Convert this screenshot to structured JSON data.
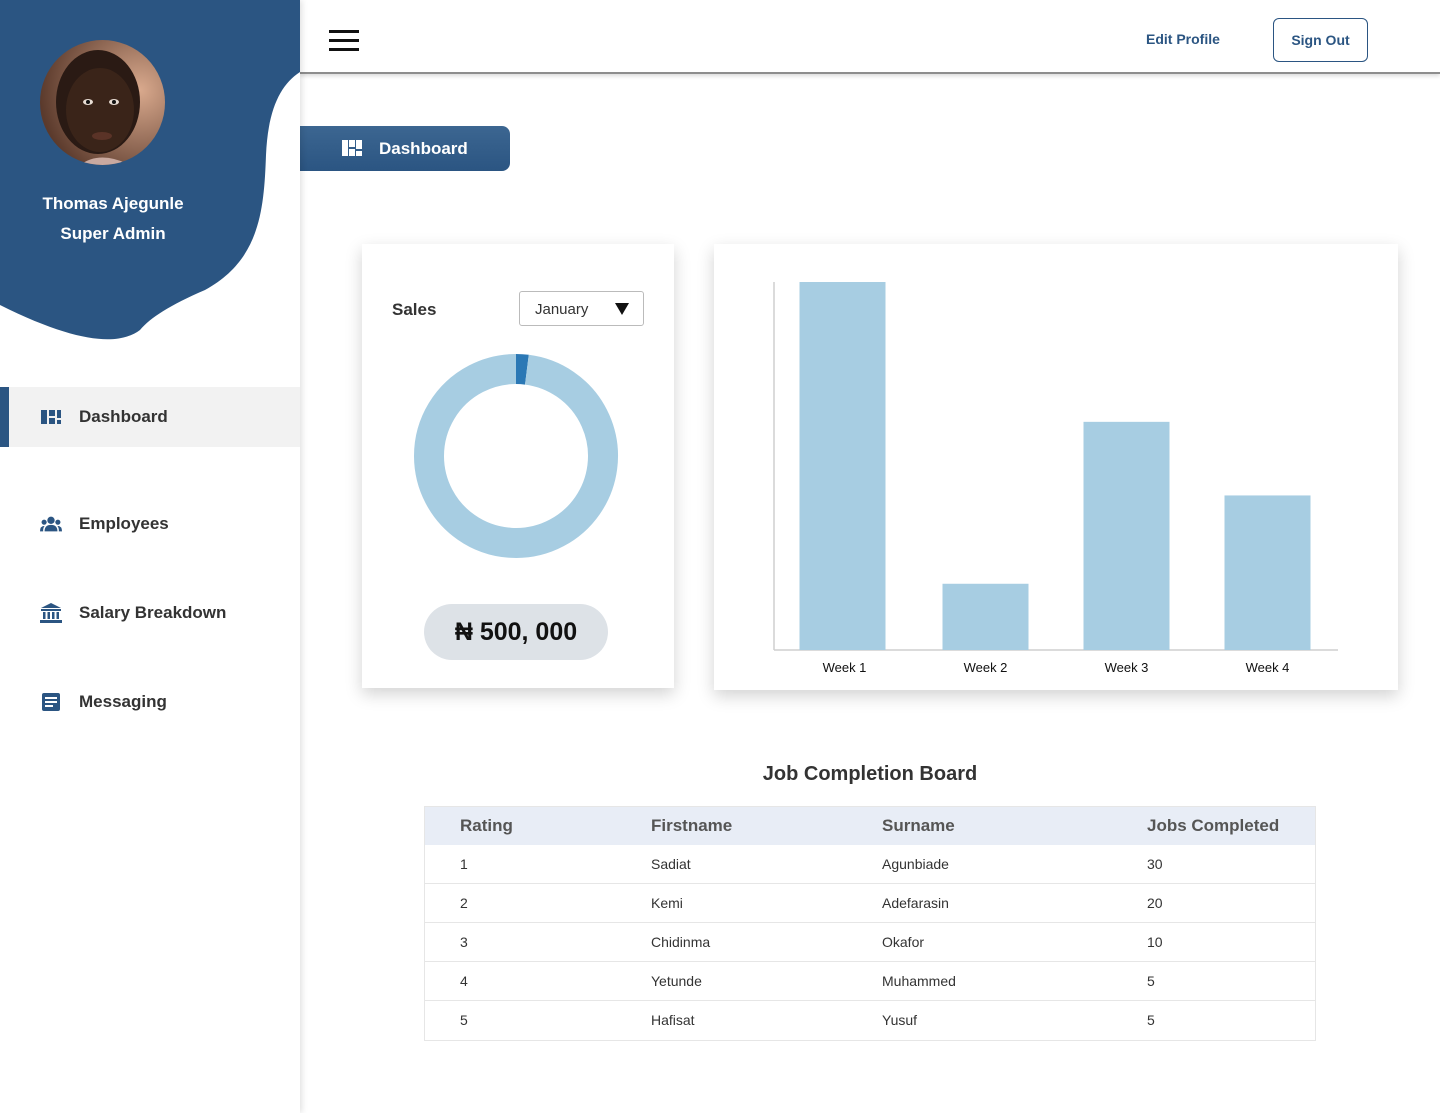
{
  "profile": {
    "name": "Thomas Ajegunle",
    "role": "Super Admin"
  },
  "sidebar": {
    "items": [
      {
        "label": "Dashboard",
        "icon": "dashboard-icon",
        "active": true
      },
      {
        "label": "Employees",
        "icon": "users-icon",
        "active": false
      },
      {
        "label": "Salary Breakdown",
        "icon": "bank-icon",
        "active": false
      },
      {
        "label": "Messaging",
        "icon": "message-icon",
        "active": false
      }
    ]
  },
  "topbar": {
    "edit_profile": "Edit Profile",
    "sign_out": "Sign Out"
  },
  "page_tab": {
    "label": "Dashboard"
  },
  "sales": {
    "title": "Sales",
    "month": "January",
    "amount": "₦ 500, 000"
  },
  "colors": {
    "brand": "#2b5582",
    "bar": "#a7cde2",
    "donut_track": "#a7cde2",
    "donut_value": "#2b78b5"
  },
  "chart_data": [
    {
      "type": "pie",
      "style": "donut",
      "values": [
        0.02,
        0.98
      ],
      "colors": [
        "#2b78b5",
        "#a7cde2"
      ]
    },
    {
      "type": "bar",
      "categories": [
        "Week 1",
        "Week 2",
        "Week 3",
        "Week 4"
      ],
      "values": [
        100,
        18,
        62,
        42
      ],
      "ylim": [
        0,
        100
      ],
      "grid": false
    }
  ],
  "board": {
    "title": "Job Completion Board",
    "columns": [
      "Rating",
      "Firstname",
      "Surname",
      "Jobs Completed"
    ],
    "rows": [
      [
        "1",
        "Sadiat",
        "Agunbiade",
        "30"
      ],
      [
        "2",
        "Kemi",
        "Adefarasin",
        "20"
      ],
      [
        "3",
        "Chidinma",
        "Okafor",
        "10"
      ],
      [
        "4",
        "Yetunde",
        "Muhammed",
        "5"
      ],
      [
        "5",
        "Hafisat",
        "Yusuf",
        "5"
      ]
    ]
  }
}
